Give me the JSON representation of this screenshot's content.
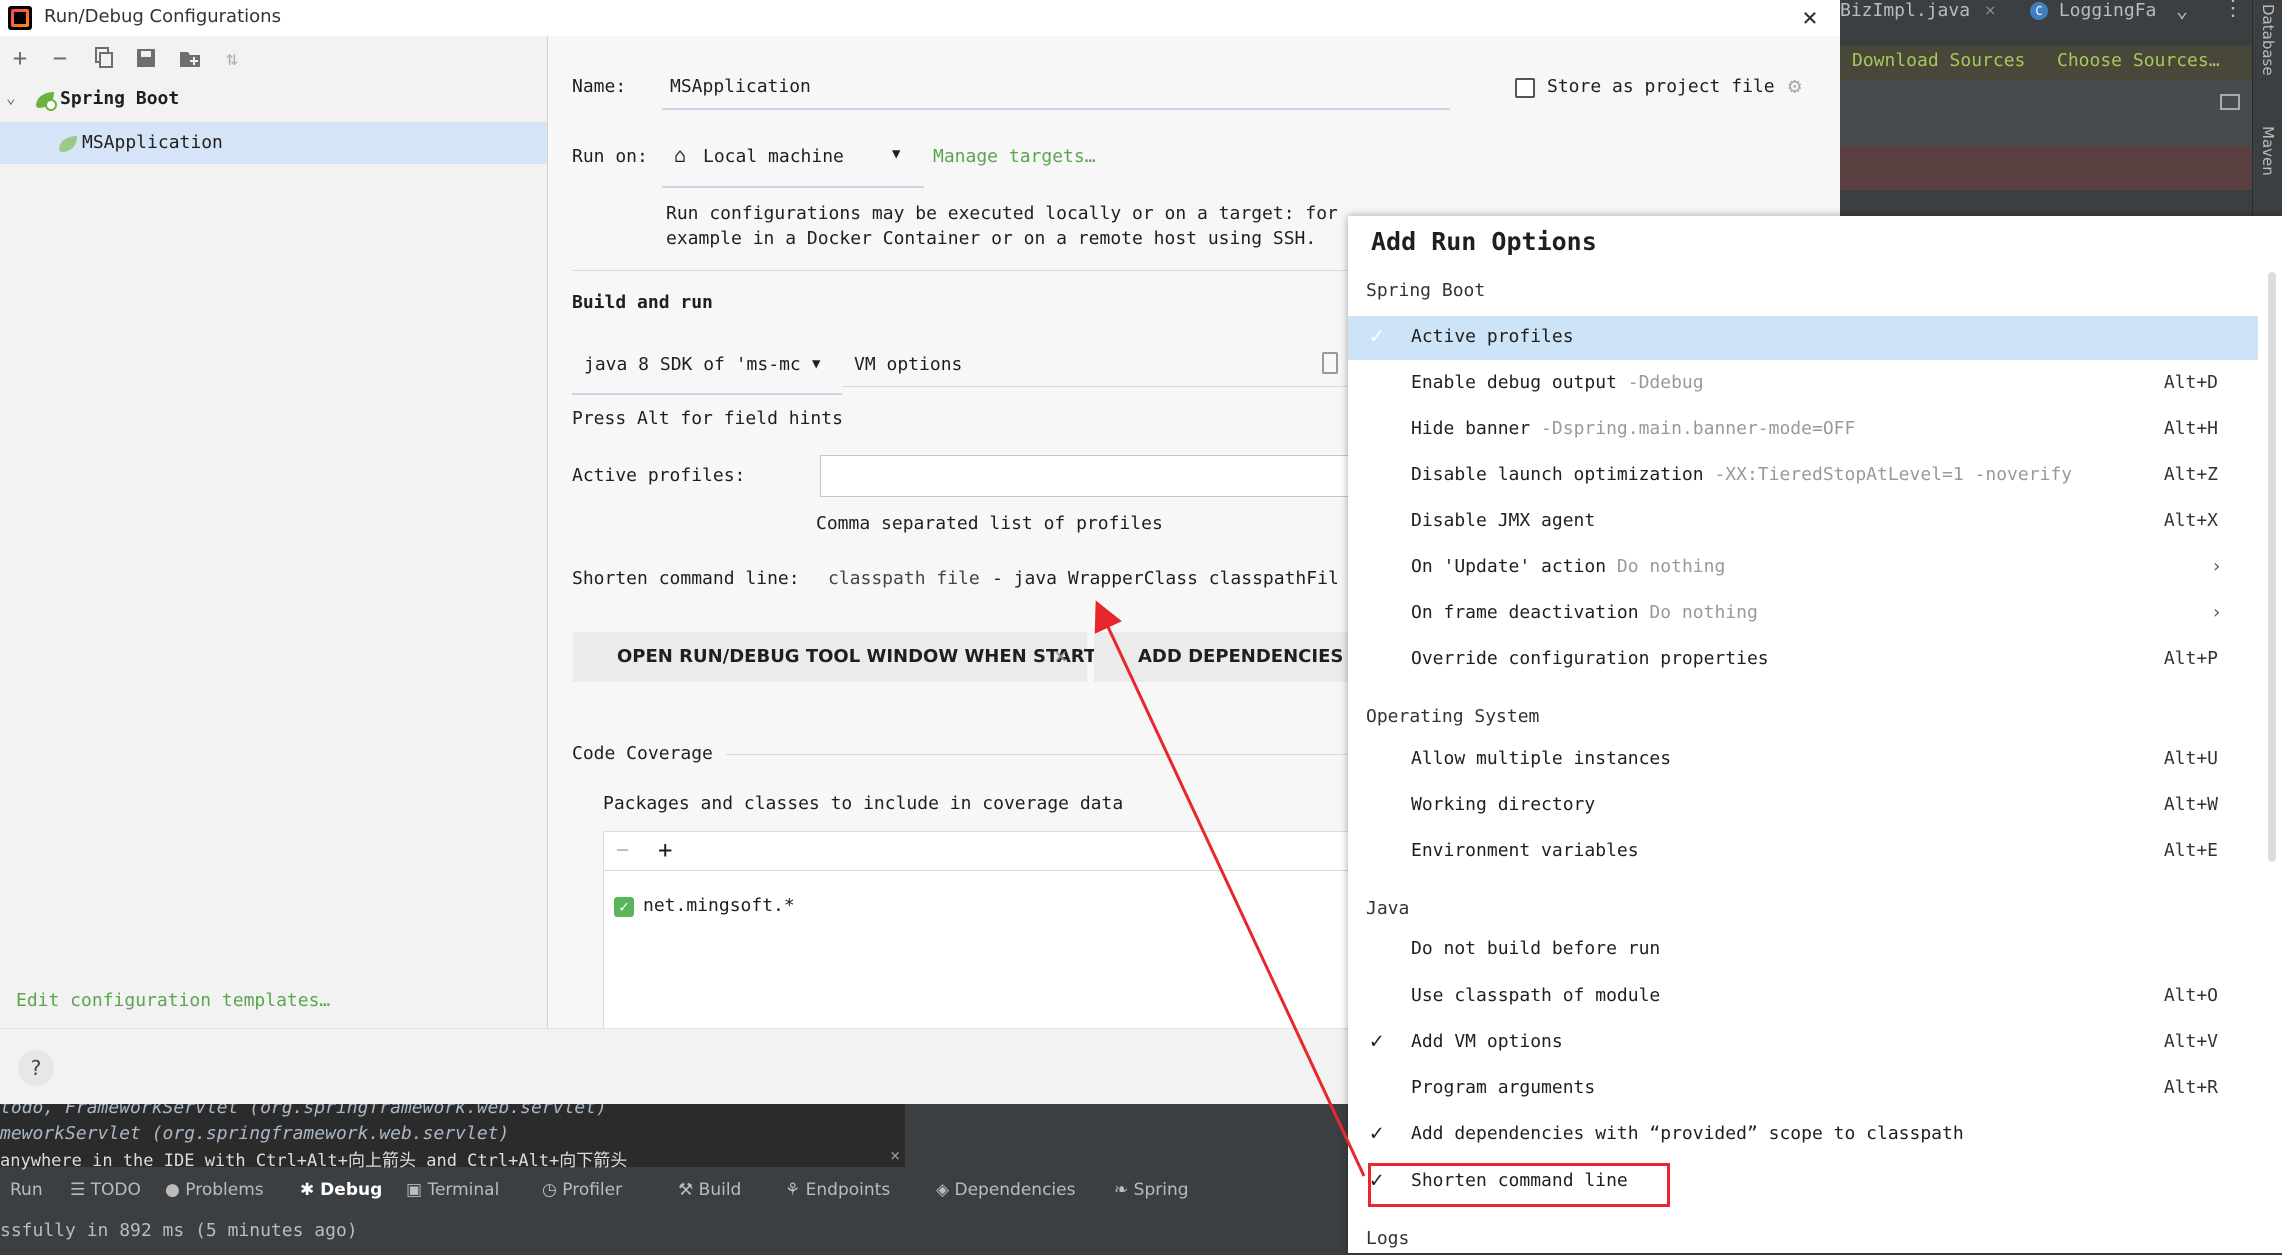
{
  "window": {
    "title": "Run/Debug Configurations",
    "close": "×",
    "app_icon": "intellij-icon"
  },
  "background_ide": {
    "tabs": [
      {
        "label": "BizImpl.java",
        "close": "×"
      },
      {
        "label": "LoggingFa",
        "icon": "class-icon"
      }
    ],
    "notification": {
      "download": "Download Sources",
      "choose": "Choose Sources…"
    },
    "right_tools": [
      "Database",
      "Maven"
    ],
    "console_lines": [
      "todo, FrameworkServlet (org.springframework.web.servlet)",
      "meworkServlet (org.springframework.web.servlet)"
    ],
    "hint": "anywhere in the IDE with Ctrl+Alt+向上箭头 and Ctrl+Alt+向下箭头",
    "hint_close": "×",
    "tool_windows": [
      "Run",
      "TODO",
      "Problems",
      "Debug",
      "Terminal",
      "Profiler",
      "Build",
      "Endpoints",
      "Dependencies",
      "Spring"
    ],
    "status": "ssfully in 892 ms (5 minutes ago)"
  },
  "tree": {
    "root": "Spring Boot",
    "child": "MSApplication",
    "edit_templates": "Edit configuration templates…"
  },
  "toolbar": {
    "add": "+",
    "remove": "−"
  },
  "form": {
    "name_label": "Name:",
    "name_value": "MSApplication",
    "store_label": "Store as project file",
    "run_on_label": "Run on:",
    "run_on_value": "Local machine",
    "manage_targets": "Manage targets…",
    "run_on_help_1": "Run configurations may be executed locally or on a target: for",
    "run_on_help_2": "example in a Docker Container or on a remote host using SSH.",
    "build_run": "Build and run",
    "sdk": "java 8 SDK of 'ms-mc",
    "vm_options": "VM options",
    "press_alt": "Press Alt for field hints",
    "active_profiles_label": "Active profiles:",
    "active_profiles_value": "",
    "active_profiles_hint": "Comma separated list of profiles",
    "shorten_label": "Shorten command line:",
    "shorten_value_1": "classpath file",
    "shorten_value_2": "- java WrapperClass classpathFil",
    "chip_1": "OPEN RUN/DEBUG TOOL WINDOW WHEN STARTED",
    "chip_1_close": "×",
    "chip_2": "ADD DEPENDENCIES WI",
    "coverage_label": "Code Coverage",
    "coverage_desc": "Packages and classes to include in coverage data",
    "coverage_item": "net.mingsoft.*",
    "coverage_remove": "−",
    "coverage_add": "+",
    "help": "?"
  },
  "popup": {
    "title": "Add Run Options",
    "groups": {
      "spring_boot": "Spring Boot",
      "os": "Operating System",
      "java": "Java",
      "logs": "Logs"
    },
    "options": {
      "active_profiles": {
        "name": "Active profiles",
        "check": "✓"
      },
      "debug_output": {
        "name": "Enable debug output",
        "hint": "-Ddebug",
        "key": "Alt+D"
      },
      "hide_banner": {
        "name": "Hide banner",
        "hint": "-Dspring.main.banner-mode=OFF",
        "key": "Alt+H"
      },
      "disable_launch": {
        "name": "Disable launch optimization",
        "hint": "-XX:TieredStopAtLevel=1 -noverify",
        "key": "Alt+Z"
      },
      "disable_jmx": {
        "name": "Disable JMX agent",
        "key": "Alt+X"
      },
      "on_update": {
        "name": "On 'Update' action",
        "hint": "Do nothing",
        "chev": "›"
      },
      "on_frame": {
        "name": "On frame deactivation",
        "hint": "Do nothing",
        "chev": "›"
      },
      "override": {
        "name": "Override configuration properties",
        "key": "Alt+P"
      },
      "multiple": {
        "name": "Allow multiple instances",
        "key": "Alt+U"
      },
      "workdir": {
        "name": "Working directory",
        "key": "Alt+W"
      },
      "env": {
        "name": "Environment variables",
        "key": "Alt+E"
      },
      "no_build": {
        "name": "Do not build before run"
      },
      "classpath": {
        "name": "Use classpath of module",
        "key": "Alt+O"
      },
      "vm": {
        "name": "Add VM options",
        "key": "Alt+V",
        "check": "✓"
      },
      "args": {
        "name": "Program arguments",
        "key": "Alt+R"
      },
      "deps": {
        "name": "Add dependencies with “provided” scope to classpath",
        "check": "✓"
      },
      "shorten": {
        "name": "Shorten command line",
        "check": "✓"
      }
    }
  }
}
